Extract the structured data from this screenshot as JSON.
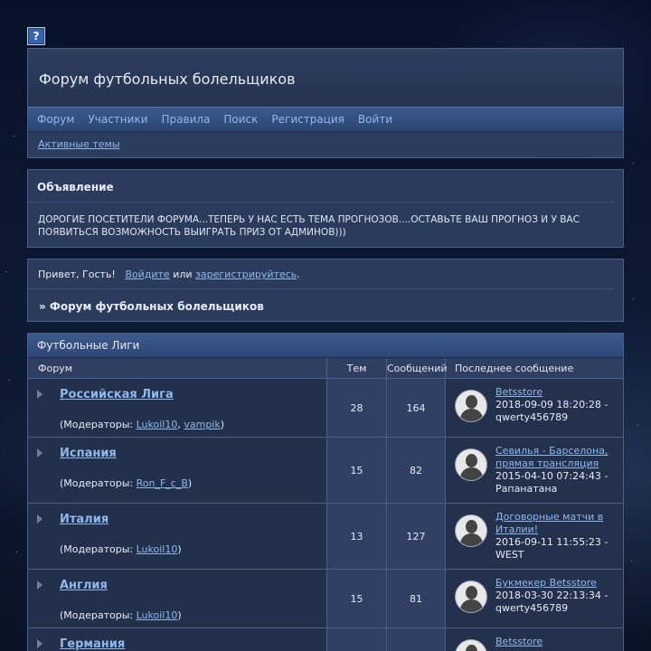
{
  "header": {
    "title": "Форум футбольных болельщиков",
    "nav": [
      "Форум",
      "Участники",
      "Правила",
      "Поиск",
      "Регистрация",
      "Войти"
    ],
    "subnav": "Активные темы"
  },
  "announcement": {
    "title": "Объявление",
    "text": "ДОРОГИЕ ПОСЕТИТЕЛИ ФОРУМА...ТЕПЕРЬ У НАС ЕСТЬ ТЕМА ПРОГНОЗОВ....ОСТАВЬТЕ ВАШ ПРОГНОЗ И У ВАС ПОЯВИТЬСЯ ВОЗМОЖНОСТЬ ВЫИГРАТЬ ПРИЗ ОТ АДМИНОВ)))"
  },
  "greeting": {
    "prefix": "Привет, Гость!",
    "login": "Войдите",
    "or": "или",
    "register": "зарегистрируйтесь",
    "suffix": ".",
    "breadcrumb": "» Форум футбольных болельщиков"
  },
  "forum": {
    "category": "Футбольные Лиги",
    "columns": {
      "forum": "Форум",
      "topics": "Тем",
      "posts": "Сообщений",
      "last": "Последнее сообщение"
    },
    "moderators_label": "(Модераторы:",
    "rows": [
      {
        "name": "Российская Лига",
        "mods": [
          "Lukoil10",
          "vampik"
        ],
        "topics": "28",
        "posts": "164",
        "last_title": "Betsstore",
        "last_date": "2018-09-09 18:20:28 -",
        "last_user": "qwerty456789"
      },
      {
        "name": "Испания",
        "mods": [
          "Ron_F_c_B"
        ],
        "topics": "15",
        "posts": "82",
        "last_title": "Севилья - Барселона, прямая трансляция",
        "last_date": "2015-04-10 07:24:43 -",
        "last_user": "Рапанатана"
      },
      {
        "name": "Италия",
        "mods": [
          "Lukoil10"
        ],
        "topics": "13",
        "posts": "127",
        "last_title": "Договорные матчи в Италии!",
        "last_date": "2016-09-11 11:55:23 -",
        "last_user": "WEST"
      },
      {
        "name": "Англия",
        "mods": [
          "Lukoil10"
        ],
        "topics": "15",
        "posts": "81",
        "last_title": "Букмекер Betsstore",
        "last_date": "2018-03-30 22:13:34 -",
        "last_user": "qwerty456789"
      },
      {
        "name": "Германия",
        "mods": [],
        "topics": "",
        "posts": "",
        "last_title": "Betsstore",
        "last_date": "",
        "last_user": ""
      }
    ]
  }
}
